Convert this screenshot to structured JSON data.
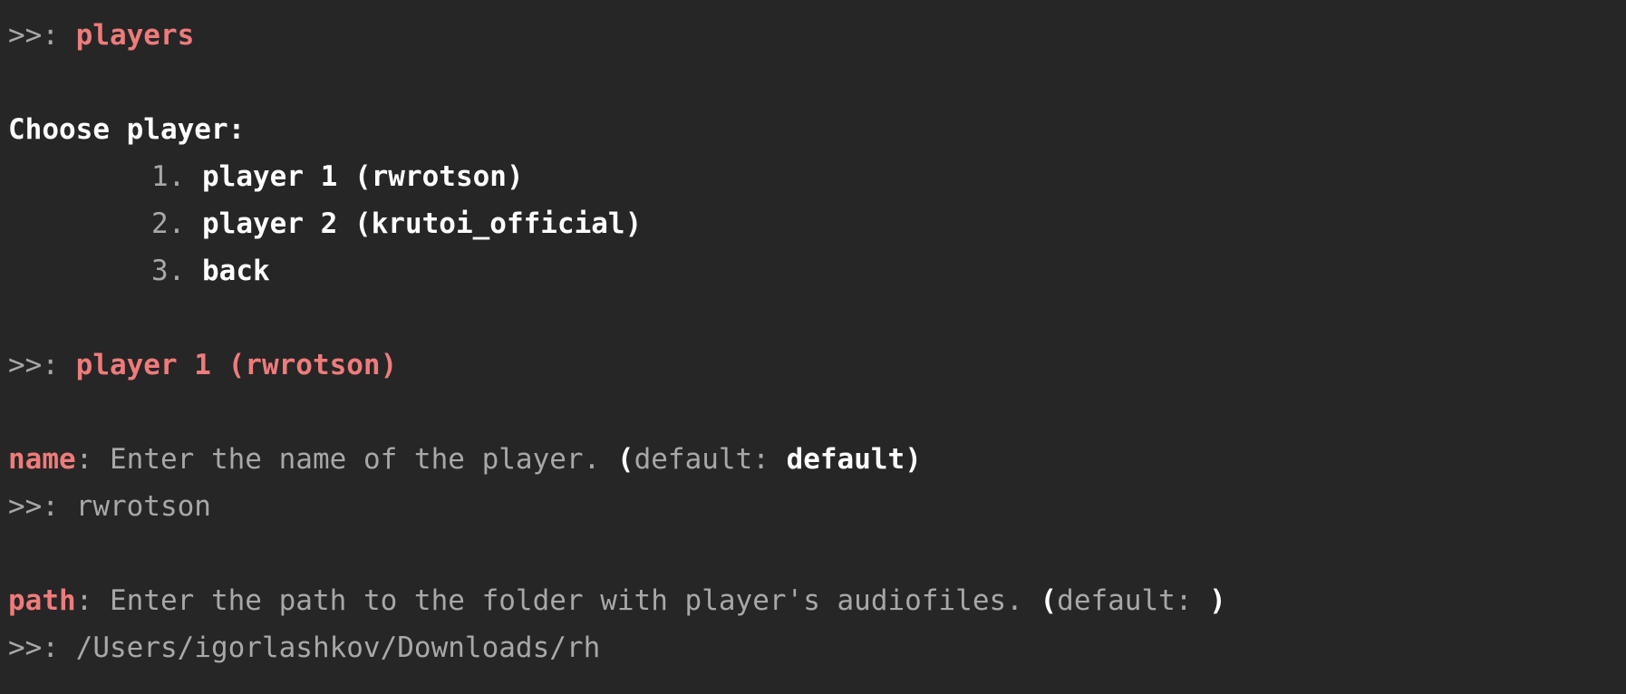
{
  "prompt_symbol": ">>: ",
  "commands": {
    "first": "players",
    "second": "player 1 (rwrotson)"
  },
  "menu": {
    "heading": "Choose player:",
    "items": [
      {
        "number": "1.",
        "label": "player 1 (rwrotson)"
      },
      {
        "number": "2.",
        "label": "player 2 (krutoi_official)"
      },
      {
        "number": "3.",
        "label": "back"
      }
    ]
  },
  "fields": [
    {
      "name": "name",
      "description": "Enter the name of the player. ",
      "default_label": "default: ",
      "default_value": "default",
      "input": "rwrotson"
    },
    {
      "name": "path",
      "description": "Enter the path to the folder with player's audiofiles. ",
      "default_label": "default: ",
      "default_value": "",
      "input": "/Users/igorlashkov/Downloads/rh"
    }
  ],
  "colors": {
    "background": "#262626",
    "command": "#ef7b7b",
    "text": "#a8a8a8",
    "emphasis": "#ffffff"
  }
}
